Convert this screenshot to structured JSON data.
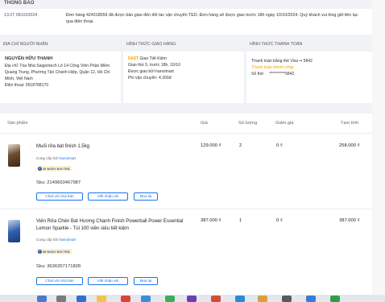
{
  "notice": {
    "title": "THÔNG BÁO",
    "time": "13:27 09/10/2024",
    "message": "Đơn hàng 424318559 đã được bàn giao đến đối tác vận chuyển TED. Đơn hàng sẽ được giao trước 18h ngày 10/10/2024. Quý khách vui lòng giữ liên lạc qua điện thoại."
  },
  "address": {
    "title": "ĐỊA CHỈ NGƯỜI NHẬN",
    "name": "NGUYỄN HỮU THANH",
    "address": "Địa chỉ: Tòa Nhà Saigontech Lô 14 Công Viên Phần Mềm Quang Trung, Phường Tân Chánh Hiệp, Quận 12, Hồ Chí Minh, Việt Nam",
    "phone": "Điện thoại: 0918788170"
  },
  "shipping": {
    "title": "HÌNH THỨC GIAO HÀNG",
    "fast": "FAST",
    "method": " Giao Tiết Kiệm",
    "eta": "Giao thứ 5, trước 18h, 10/10",
    "by_label": "Được giao bởi ",
    "by_value": "hanoimart",
    "fee": "Phí vận chuyển: 4.300đ"
  },
  "payment": {
    "title": "HÌNH THỨC THANH TOÁN",
    "method": "Thanh toán bằng thẻ Visa •• 5842",
    "status": "Thanh toán thành công",
    "card_label": "Số thẻ:",
    "card_number": "**********5842"
  },
  "table_headers": {
    "product": "Sản phẩm",
    "price": "Giá",
    "qty": "Số lượng",
    "discount": "Giảm giá",
    "subtotal": "Tạm tính"
  },
  "products": [
    {
      "name": "Muối rửa bát finish 1.5kg",
      "supplier_label": "Cung cấp bởi ",
      "supplier": "hanoimart",
      "badge": "30 NGÀY ĐỔI TRẢ",
      "sku": "Sku: 2149663467987",
      "price": "129.000 ₫",
      "qty": "2",
      "discount": "0 ₫",
      "subtotal": "258.000 ₫",
      "buttons": [
        "Chat với nhà bán",
        "Viết nhận xét",
        "Mua lại"
      ]
    },
    {
      "name": "Viên Rửa Chén Bát Hương Chanh Finish Powerball Power Essential Lemon Sparkle - Túi 100 viên siêu tiết kiệm",
      "supplier_label": "Cung cấp bởi ",
      "supplier": "hanoimart",
      "badge": "30 NGÀY ĐỔI TRẢ",
      "sku": "Sku: 3636357171828",
      "price": "387.000 ₫",
      "qty": "1",
      "discount": "0 ₫",
      "subtotal": "387.000 ₫",
      "buttons": [
        "Chat với nhà bán",
        "Viết nhận xét",
        "Mua lại"
      ]
    }
  ],
  "colors": {
    "accent": "#1a73e8",
    "fast": "#f5a300",
    "badge_bg": "#fff3cf"
  }
}
